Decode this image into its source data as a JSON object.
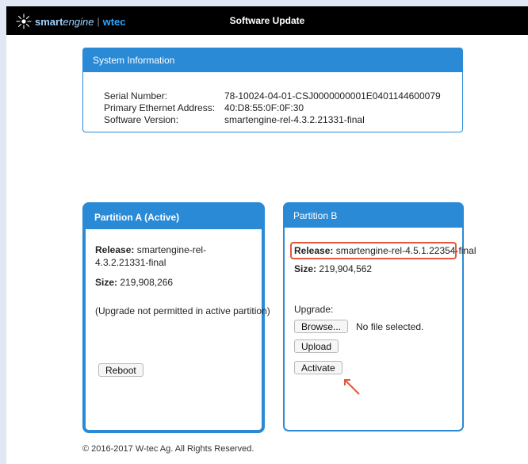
{
  "header": {
    "brand_smart": "smart",
    "brand_engine": "engine",
    "brand_sep": "|",
    "brand_wtec": "wtec",
    "title": "Software Update"
  },
  "system_info": {
    "title": "System Information",
    "rows": [
      {
        "label": "Serial Number:",
        "value": "78-10024-04-01-CSJ0000000001E0401144600079"
      },
      {
        "label": "Primary Ethernet Address:",
        "value": "40:D8:55:0F:0F:30"
      },
      {
        "label": "Software Version:",
        "value": "smartengine-rel-4.3.2.21331-final"
      }
    ]
  },
  "partition_a": {
    "title": "Partition A (Active)",
    "release_label": "Release:",
    "release_value": "smartengine-rel-4.3.2.21331-final",
    "size_label": "Size:",
    "size_value": "219,908,266",
    "note": "(Upgrade not permitted in active partition)",
    "reboot_label": "Reboot"
  },
  "partition_b": {
    "title": "Partition B",
    "release_label": "Release:",
    "release_value": "smartengine-rel-4.5.1.22354-final",
    "size_label": "Size:",
    "size_value": "219,904,562",
    "upgrade_label": "Upgrade:",
    "browse_label": "Browse...",
    "file_status": "No file selected.",
    "upload_label": "Upload",
    "activate_label": "Activate"
  },
  "footer": {
    "copyright": "© 2016-2017 W-tec Ag. All Rights Reserved."
  },
  "colors": {
    "accent": "#2a8ad6",
    "highlight": "#e5573e",
    "header_bg": "#000000"
  }
}
